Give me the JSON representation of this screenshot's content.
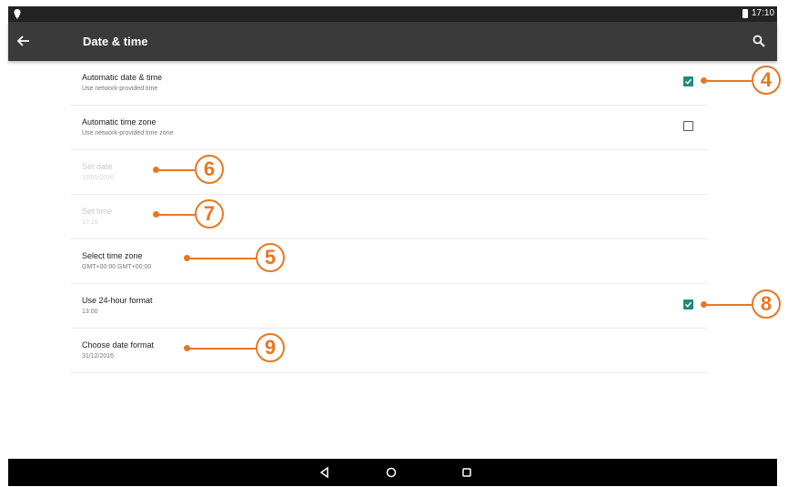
{
  "status_bar": {
    "time": "17:10"
  },
  "app_bar": {
    "title": "Date & time"
  },
  "settings": [
    {
      "title": "Automatic date & time",
      "subtitle": "Use network-provided time",
      "checkbox": "checked",
      "enabled": true
    },
    {
      "title": "Automatic time zone",
      "subtitle": "Use network-provided time zone",
      "checkbox": "unchecked",
      "enabled": true
    },
    {
      "title": "Set date",
      "subtitle": "22/01/2016",
      "enabled": false
    },
    {
      "title": "Set time",
      "subtitle": "17:10",
      "enabled": false
    },
    {
      "title": "Select time zone",
      "subtitle": "GMT+00:00 GMT+00:00",
      "enabled": true
    },
    {
      "title": "Use 24-hour format",
      "subtitle": "13:00",
      "checkbox": "checked",
      "enabled": true
    },
    {
      "title": "Choose date format",
      "subtitle": "31/12/2016",
      "enabled": true
    }
  ],
  "callouts": [
    "4",
    "6",
    "7",
    "5",
    "8",
    "9"
  ],
  "colors": {
    "accent": "#1e8b7a",
    "callout": "#e87722",
    "app_bar": "#3a3a3a",
    "status_bar": "#232323",
    "nav_bar": "#000000"
  },
  "icons": {
    "back": "arrow-left-icon",
    "search": "search-icon",
    "nav": [
      "back-triangle-icon",
      "home-circle-icon",
      "recents-square-icon"
    ]
  }
}
